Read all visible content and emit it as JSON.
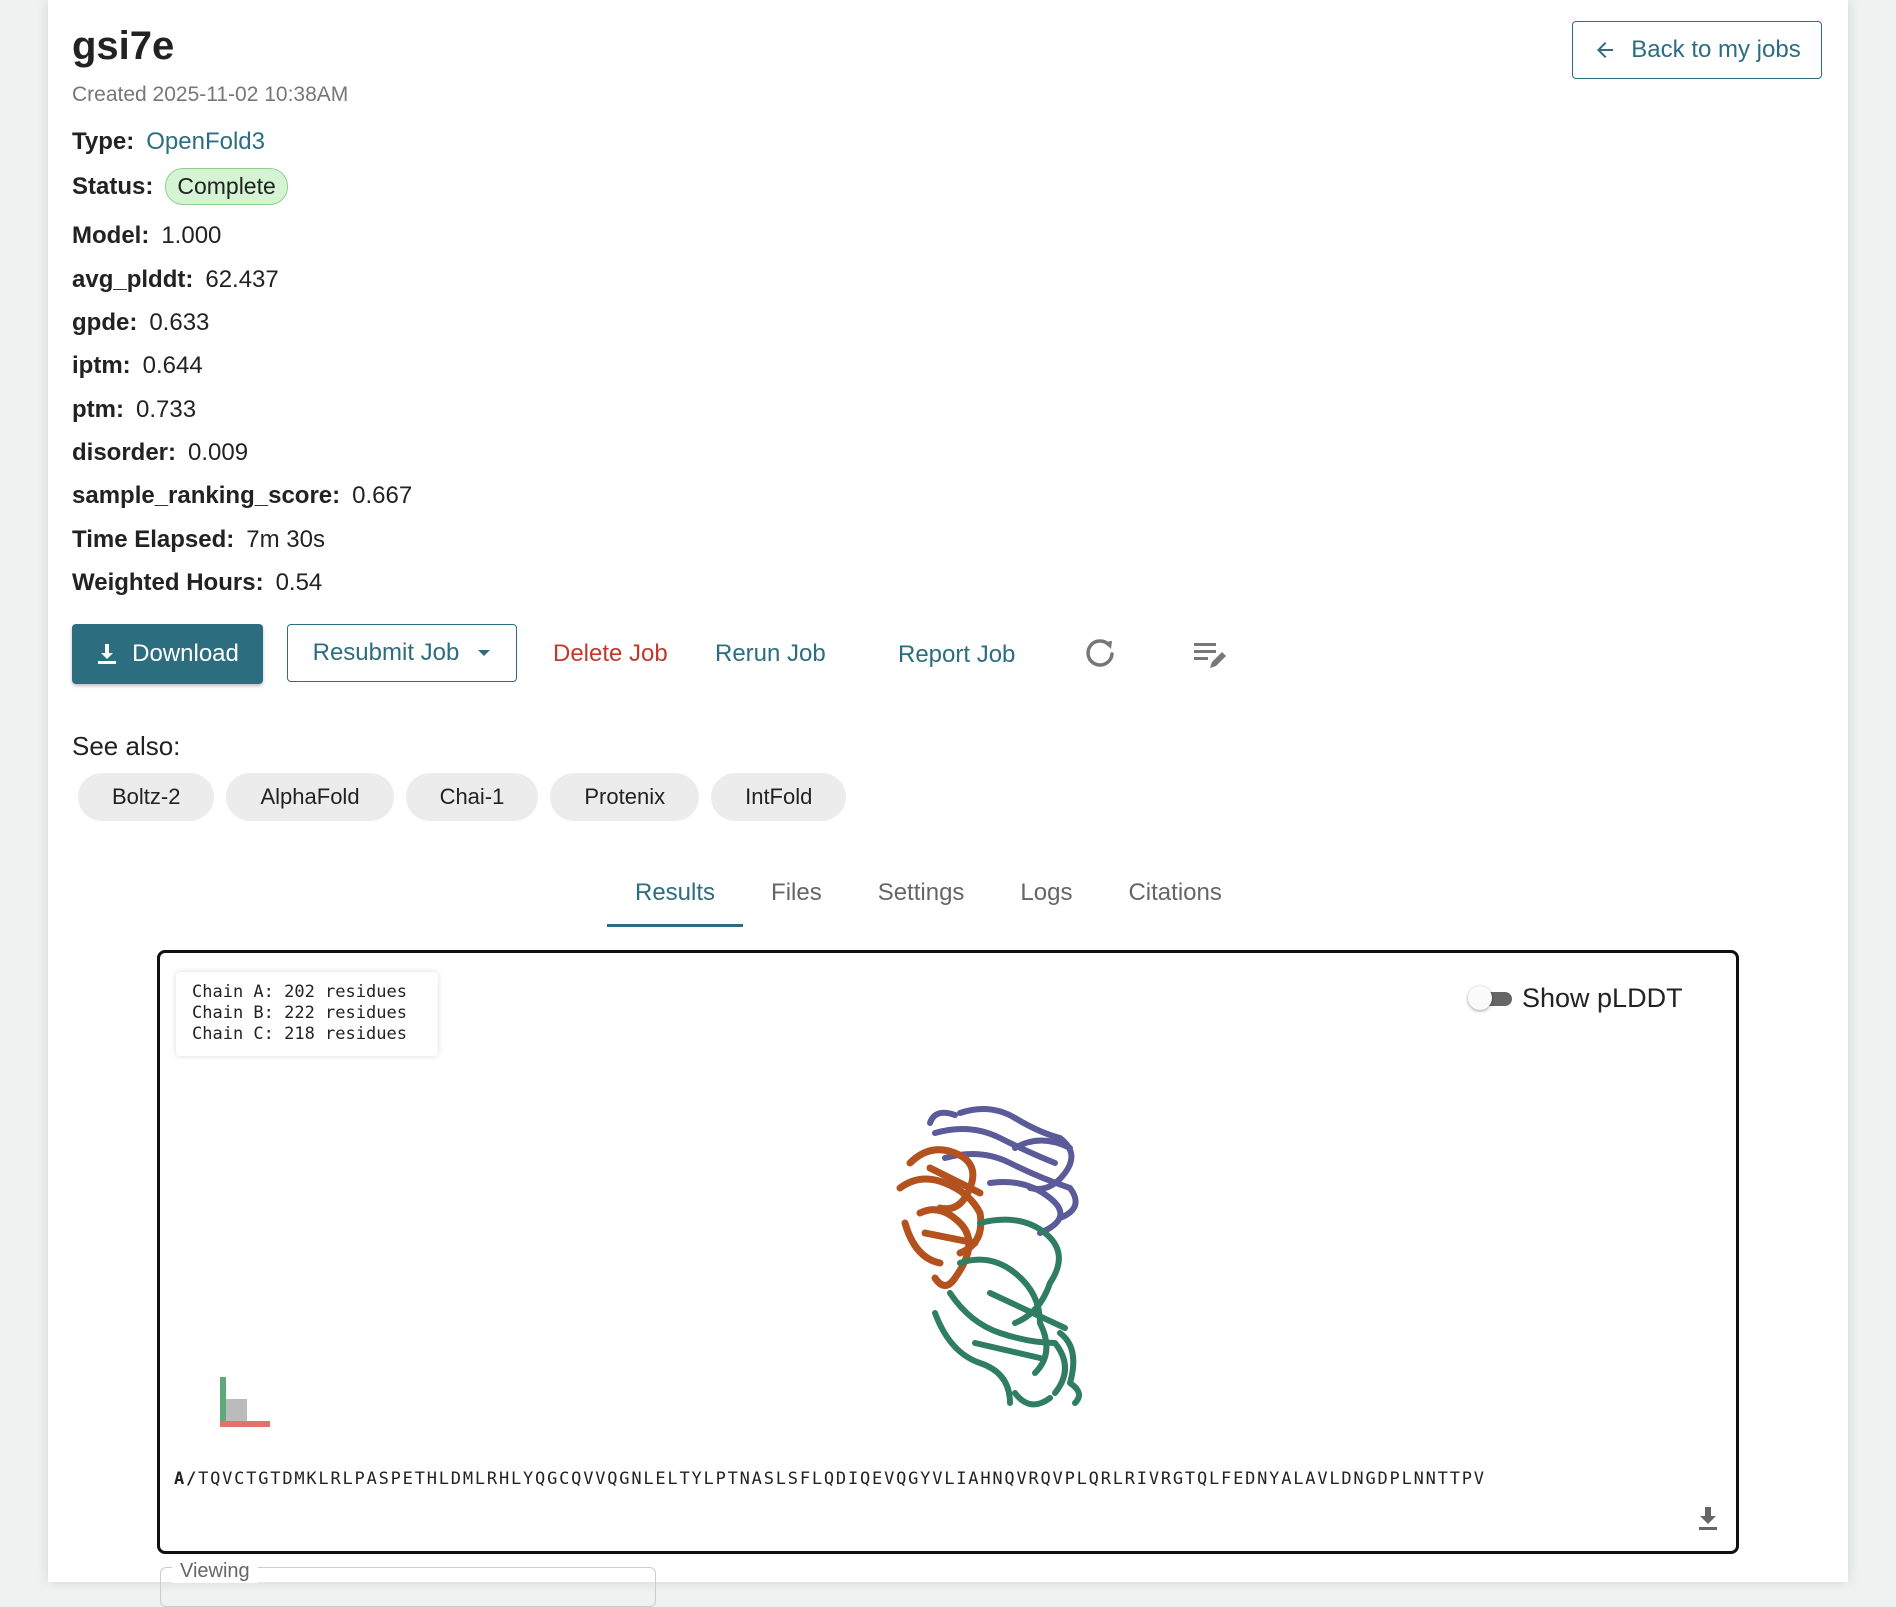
{
  "job": {
    "name": "gsi7e",
    "created": "Created 2025-11-02 10:38AM",
    "back_label": "Back to my jobs"
  },
  "fields": {
    "type_label": "Type:",
    "type_value": "OpenFold3",
    "status_label": "Status:",
    "status_value": "Complete",
    "model_label": "Model:",
    "model_value": "1.000",
    "avg_plddt_label": "avg_plddt:",
    "avg_plddt_value": "62.437",
    "gpde_label": "gpde:",
    "gpde_value": "0.633",
    "iptm_label": "iptm:",
    "iptm_value": "0.644",
    "ptm_label": "ptm:",
    "ptm_value": "0.733",
    "disorder_label": "disorder:",
    "disorder_value": "0.009",
    "sample_ranking_label": "sample_ranking_score:",
    "sample_ranking_value": "0.667",
    "time_label": "Time Elapsed:",
    "time_value": "7m 30s",
    "hours_label": "Weighted Hours:",
    "hours_value": "0.54"
  },
  "actions": {
    "download": "Download",
    "resubmit": "Resubmit Job",
    "delete": "Delete Job",
    "rerun": "Rerun Job",
    "report": "Report Job"
  },
  "see_also": {
    "label": "See also:",
    "chips": [
      "Boltz-2",
      "AlphaFold",
      "Chai-1",
      "Protenix",
      "IntFold"
    ]
  },
  "tabs": [
    "Results",
    "Files",
    "Settings",
    "Logs",
    "Citations"
  ],
  "viewer": {
    "chains": [
      "Chain A: 202 residues",
      "Chain B: 222 residues",
      "Chain C: 218 residues"
    ],
    "toggle_label": "Show pLDDT",
    "sequence_prefix": "A/",
    "sequence": "TQVCTGTDMKLRLPASPETHLDMLRHLYQGCQVVQGNLELTYLPTNASLSFLQDIQEVQGYVLIAHNQVRQVPLQRLRIVRGTQLFEDNYALAVLDNGDPLNNTTPV",
    "viewing_label": "Viewing"
  },
  "colors": {
    "accent": "#2c6e80",
    "danger": "#c0392b",
    "chain_a": "#5b5b9a",
    "chain_b": "#b4521f",
    "chain_c": "#2f7d62",
    "status_bg": "#d4f4d4"
  }
}
